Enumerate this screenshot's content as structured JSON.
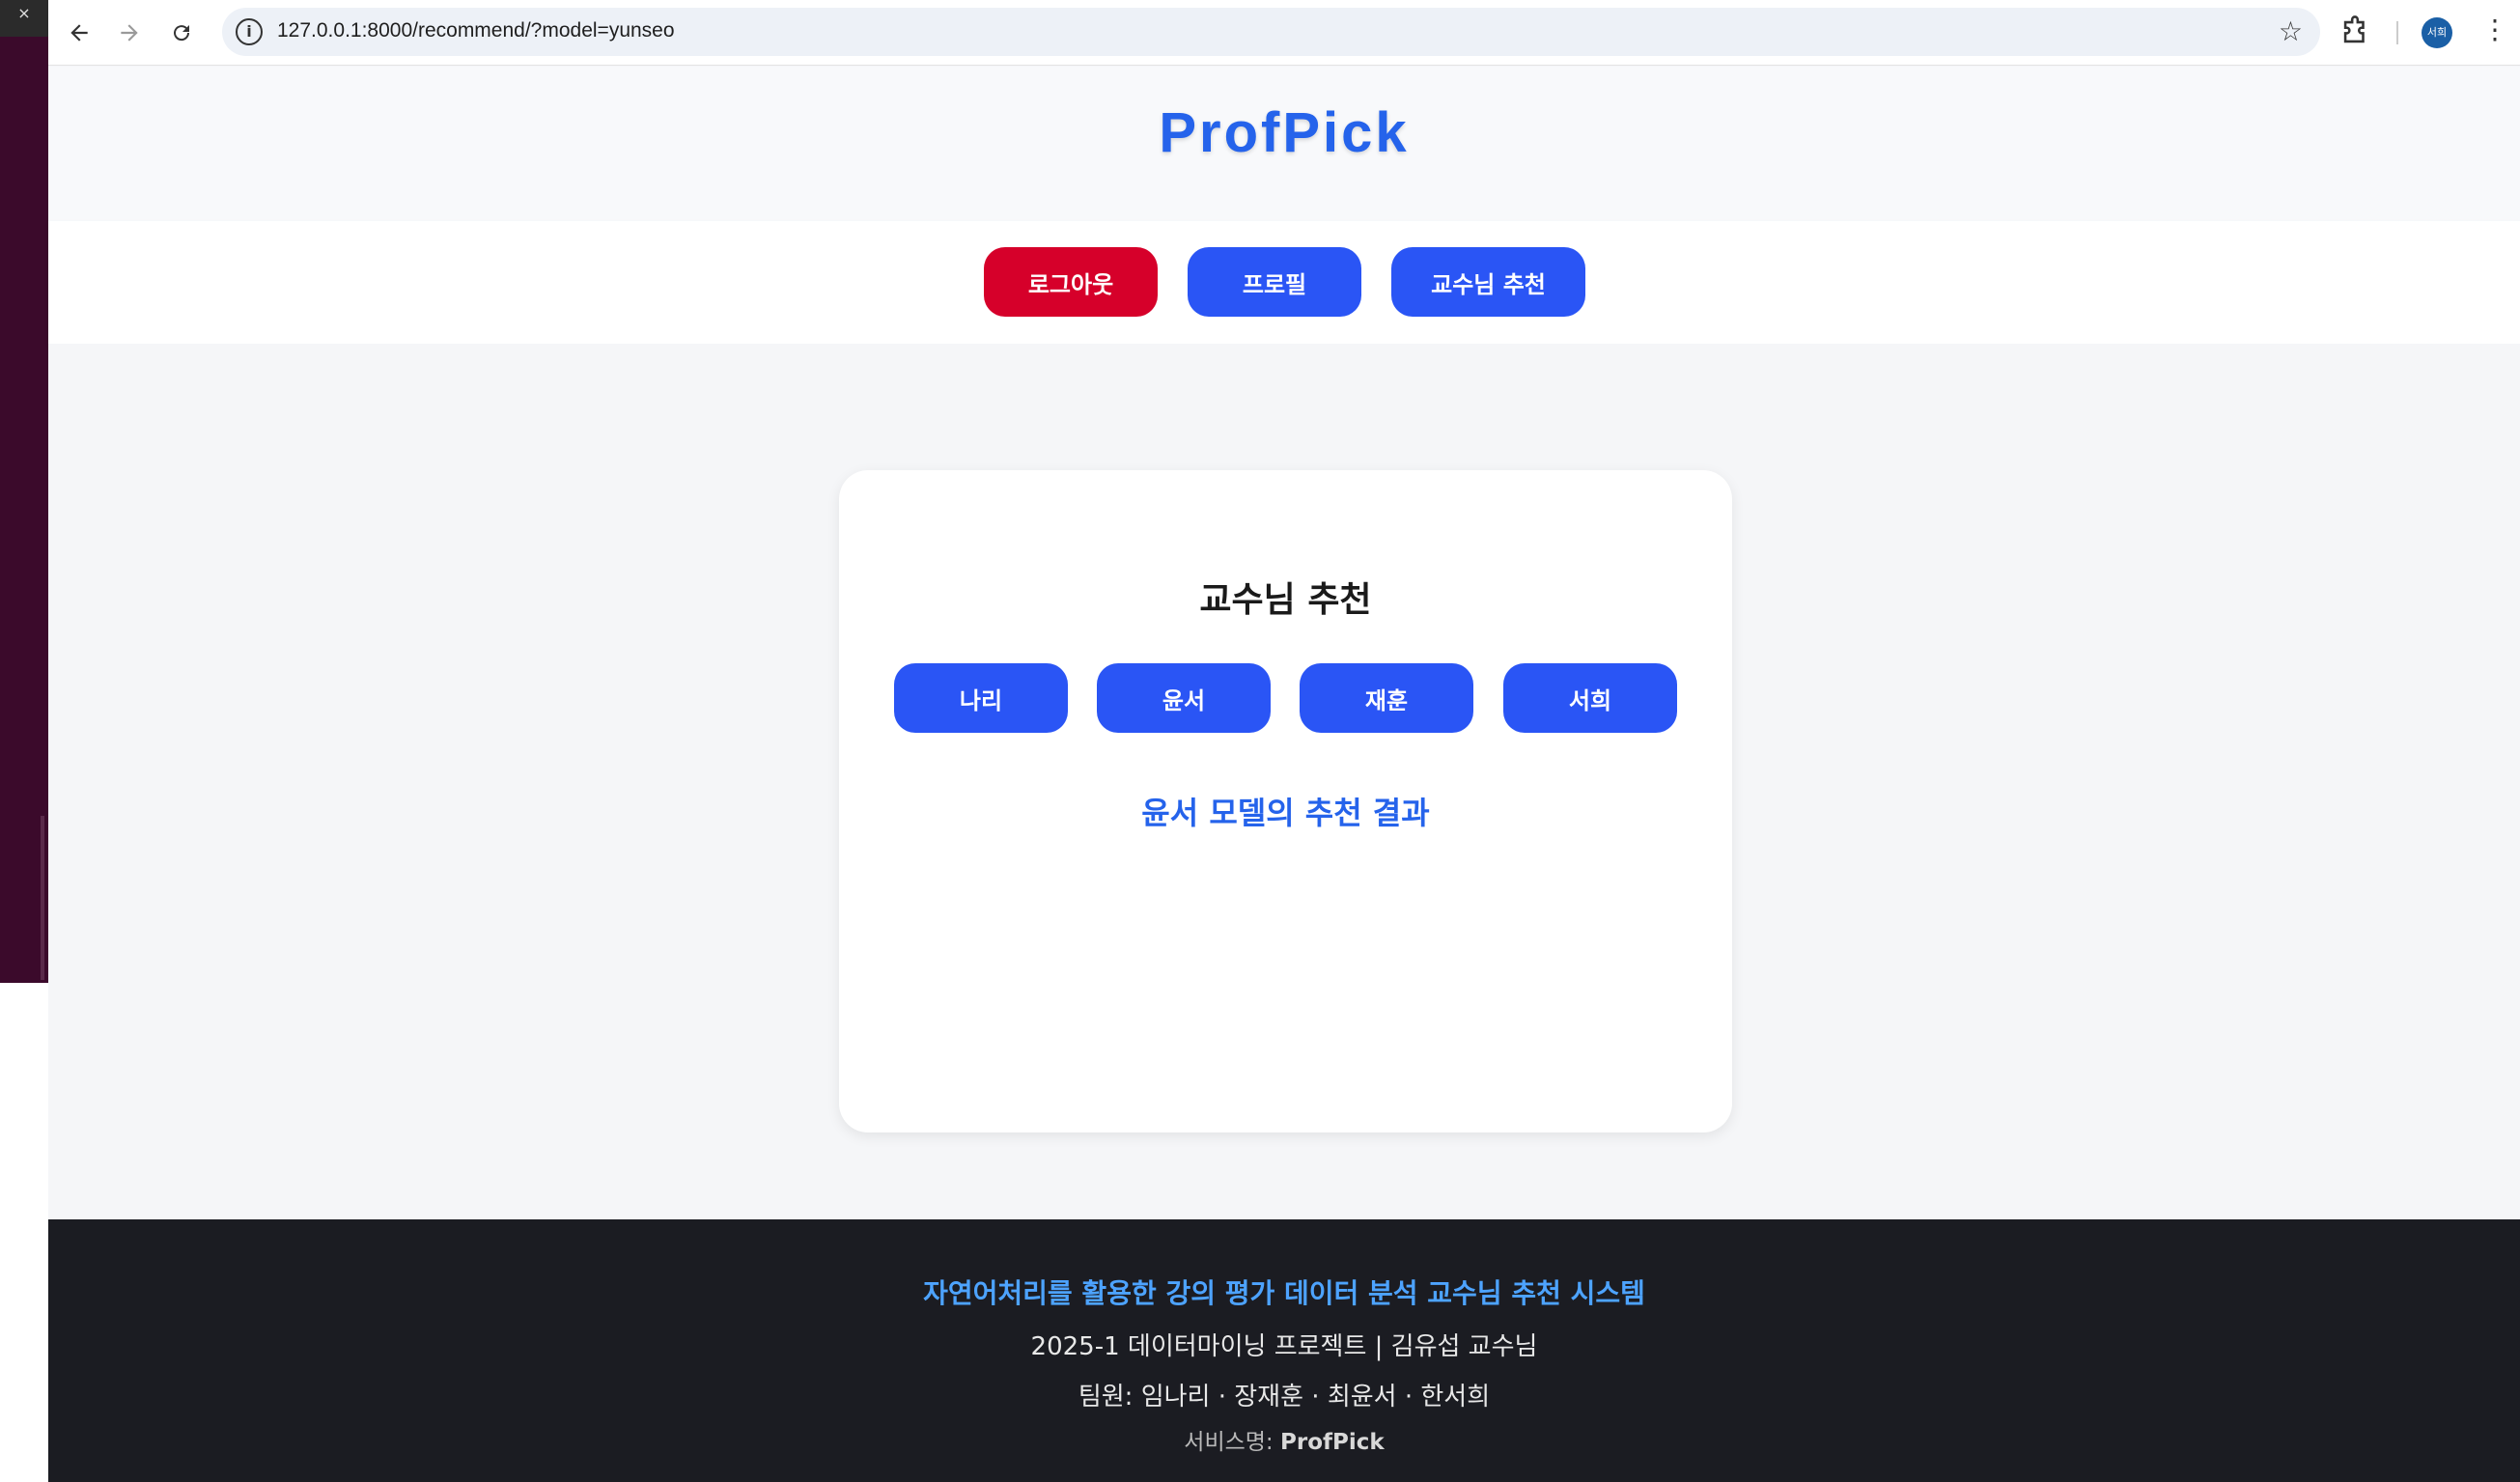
{
  "browser": {
    "url": "127.0.0.1:8000/recommend/?model=yunseo",
    "profile_initials": "서희"
  },
  "site": {
    "brand": "ProfPick"
  },
  "nav": {
    "logout": "로그아웃",
    "profile": "프로필",
    "recommend": "교수님 추천"
  },
  "card": {
    "title": "교수님 추천",
    "models": [
      "나리",
      "윤서",
      "재훈",
      "서희"
    ],
    "result_title": "윤서 모델의 추천 결과"
  },
  "footer": {
    "title": "자연어처리를 활용한 강의 평가 데이터 분석 교수님 추천 시스템",
    "project": "2025-1 데이터마이닝 프로젝트 | 김유섭 교수님",
    "team": "팀원: 임나리 · 장재훈 · 최윤서 · 한서희",
    "service_label": "서비스명:",
    "service_name": "ProfPick"
  },
  "colors": {
    "brand": "#2563eb",
    "logout_button": "#d6002a",
    "primary_button": "#2a55f5",
    "footer_bg": "#1b1c22",
    "footer_title": "#4da3ff"
  }
}
